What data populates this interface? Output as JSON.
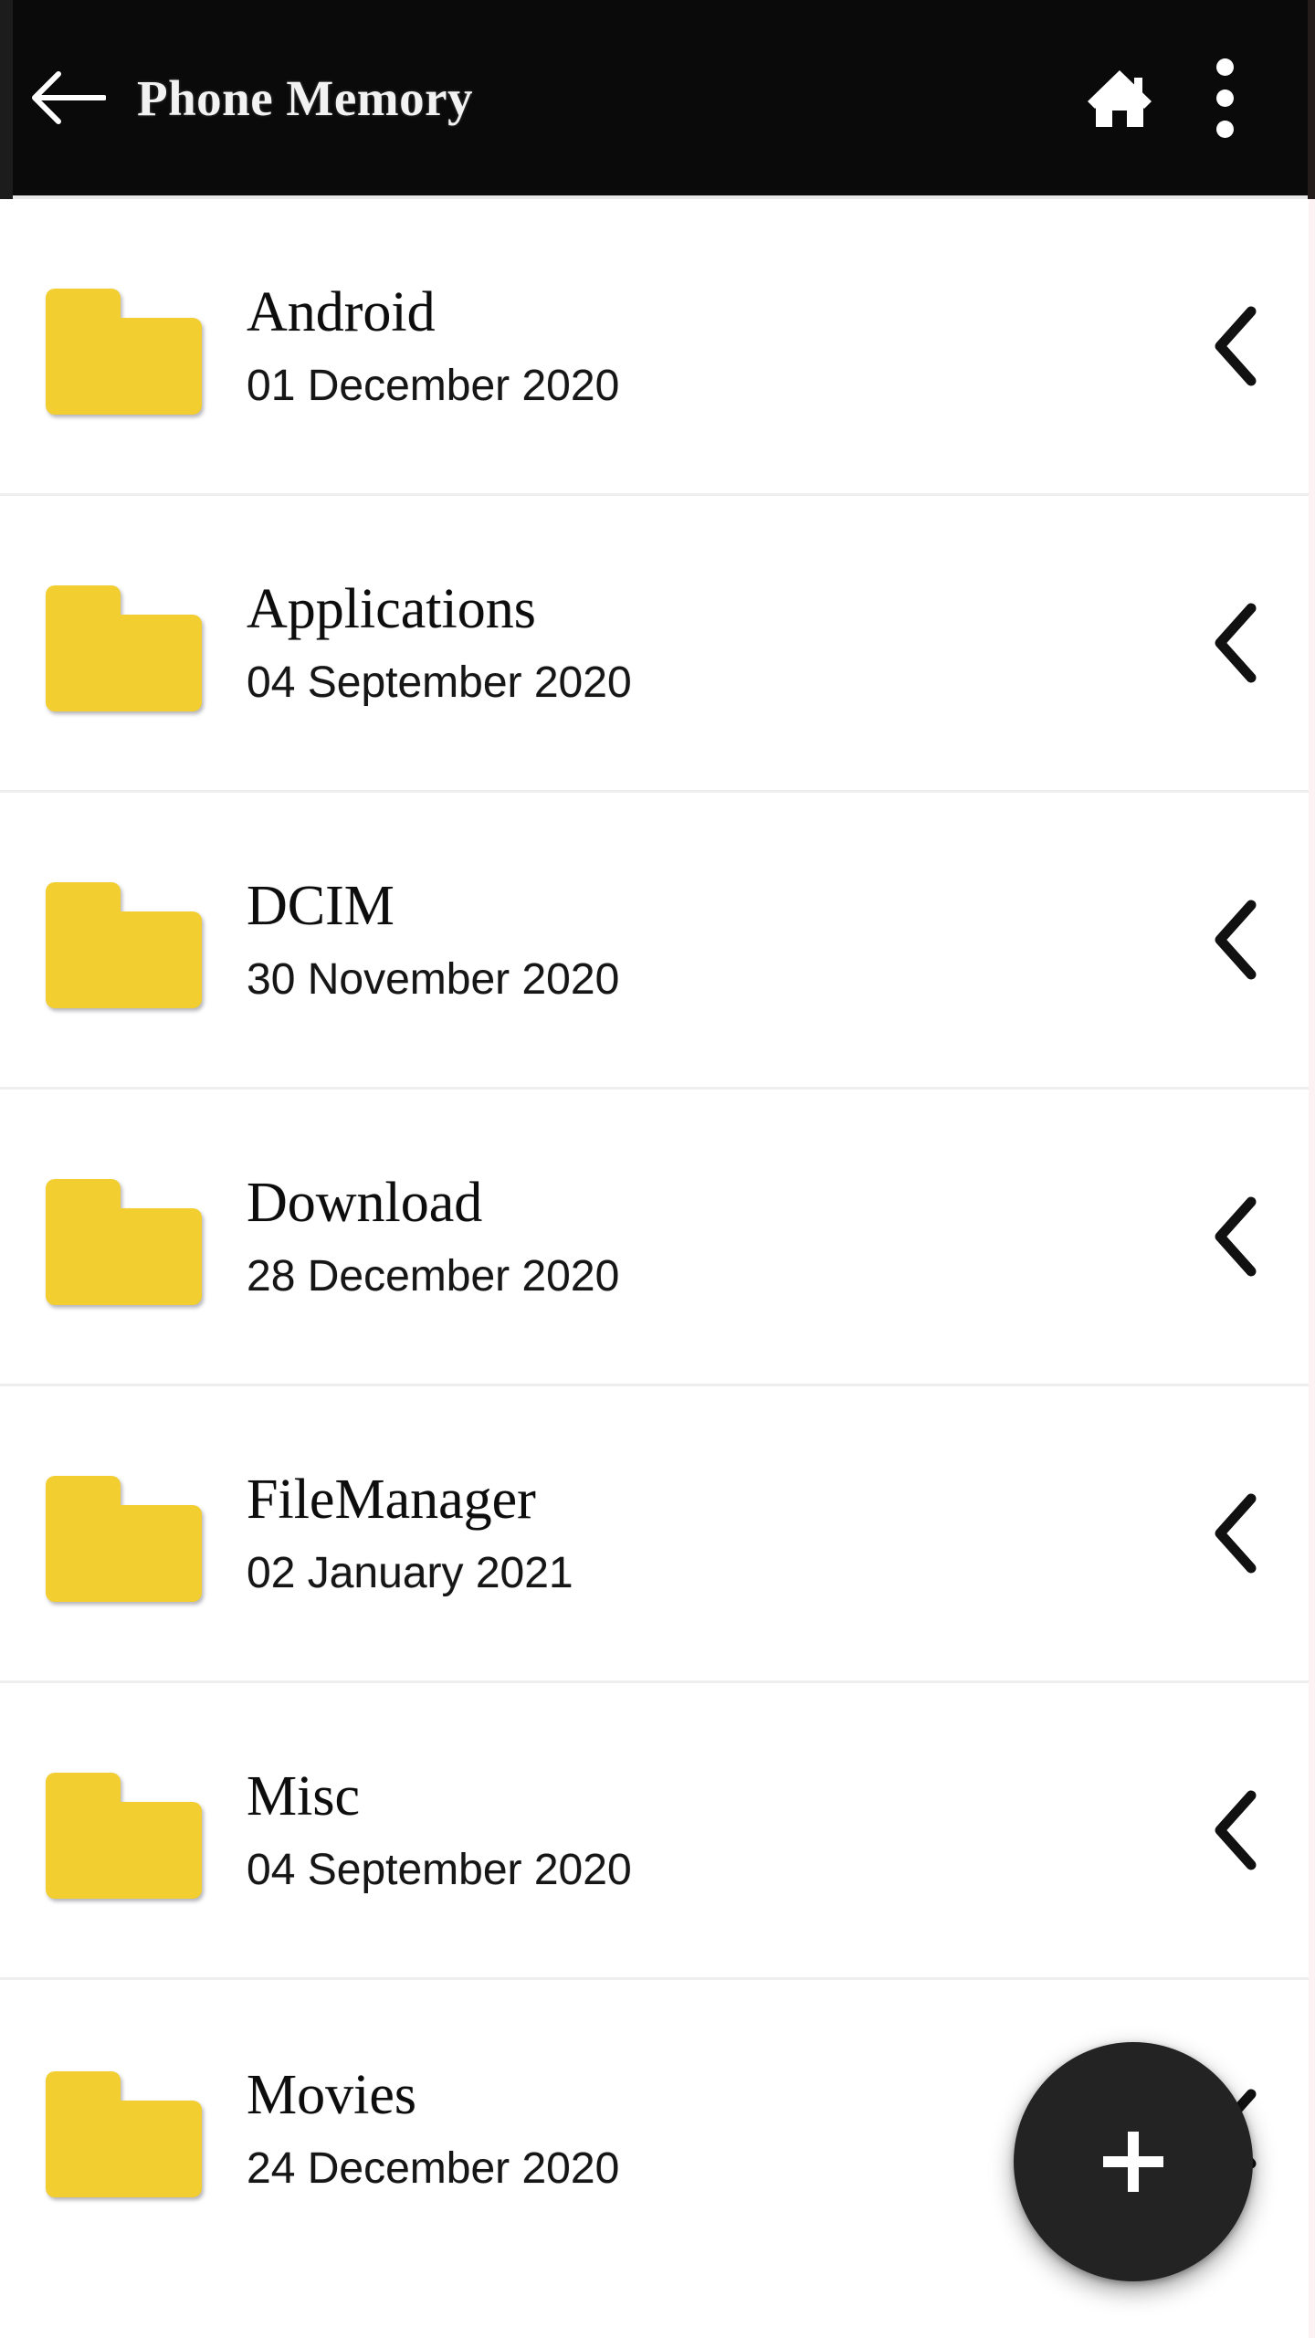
{
  "appbar": {
    "title": "Phone Memory",
    "back_icon": "arrow-left-icon",
    "home_icon": "home-icon",
    "overflow_icon": "more-vertical-icon",
    "background_color": "#0a0a0a",
    "text_color": "#f2f2f2"
  },
  "list": {
    "folder_icon": "folder-icon",
    "chevron_icon": "chevron-left-icon",
    "folder_color": "#F2CE31",
    "items": [
      {
        "name": "Android",
        "date": "01 December 2020"
      },
      {
        "name": "Applications",
        "date": "04 September 2020"
      },
      {
        "name": "DCIM",
        "date": "30 November 2020"
      },
      {
        "name": "Download",
        "date": "28 December 2020"
      },
      {
        "name": "FileManager",
        "date": "02 January 2021"
      },
      {
        "name": "Misc",
        "date": "04 September 2020"
      },
      {
        "name": "Movies",
        "date": "24 December 2020"
      }
    ]
  },
  "fab": {
    "icon": "plus-icon",
    "label": "+",
    "background_color": "#232323"
  }
}
